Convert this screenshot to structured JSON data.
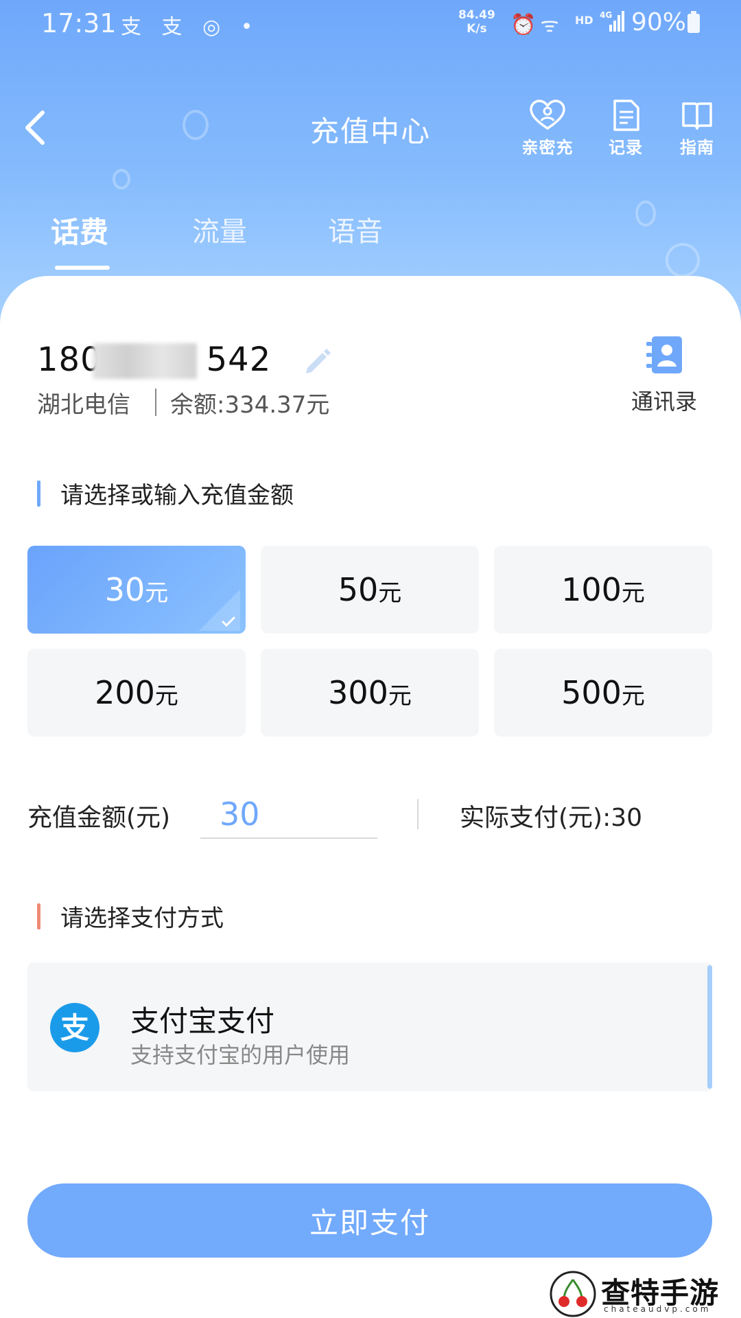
{
  "status_bar": {
    "time": "17:31",
    "left_icons": "支 支 ◎ •",
    "net_speed_value": "84.49",
    "net_speed_unit": "K/s",
    "hd": "HD",
    "signal": "4G",
    "battery": "90%"
  },
  "header": {
    "title": "充值中心",
    "actions": [
      {
        "label": "亲密充",
        "icon": "heart-user-icon"
      },
      {
        "label": "记录",
        "icon": "document-icon"
      },
      {
        "label": "指南",
        "icon": "book-icon"
      }
    ]
  },
  "tabs": [
    {
      "label": "话费",
      "active": true
    },
    {
      "label": "流量",
      "active": false
    },
    {
      "label": "语音",
      "active": false
    }
  ],
  "account": {
    "phone_prefix": "180",
    "phone_suffix": "542",
    "carrier": "湖北电信",
    "balance": "余额:334.37元",
    "contacts_label": "通讯录"
  },
  "amount_section": {
    "title": "请选择或输入充值金额",
    "unit": "元",
    "options": [
      {
        "value": "30",
        "selected": true
      },
      {
        "value": "50",
        "selected": false
      },
      {
        "value": "100",
        "selected": false
      },
      {
        "value": "200",
        "selected": false
      },
      {
        "value": "300",
        "selected": false
      },
      {
        "value": "500",
        "selected": false
      }
    ]
  },
  "charge": {
    "label": "充值金额(元)",
    "value": "30",
    "actual_pay": "实际支付(元):30"
  },
  "payment_section": {
    "title": "请选择支付方式",
    "method_name": "支付宝支付",
    "method_desc": "支持支付宝的用户使用"
  },
  "pay_button": "立即支付",
  "watermark": {
    "text": "查特手游网",
    "sub": "chateaudvp.com"
  },
  "colors": {
    "accent": "#6fa8fb",
    "payment_accent": "#f08a76",
    "alipay": "#1a9bea"
  }
}
